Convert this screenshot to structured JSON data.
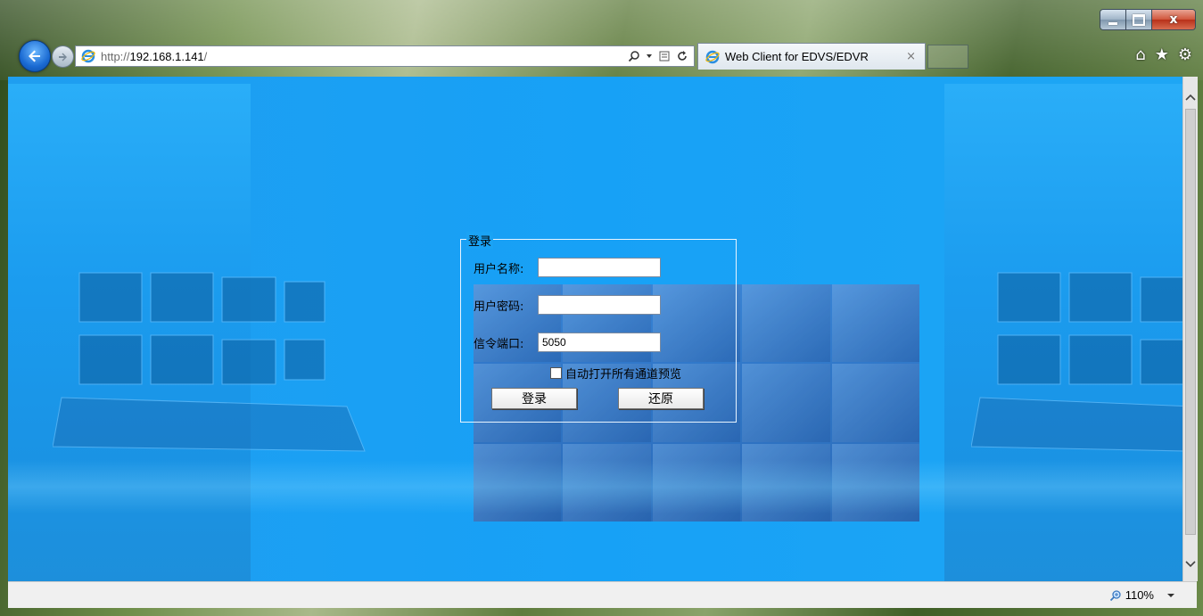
{
  "browser": {
    "url_prefix": "http://",
    "url_host": "192.168.1.141",
    "url_suffix": "/",
    "tab_title": "Web Client for EDVS/EDVR",
    "tab_close": "×",
    "zoom": "110%"
  },
  "login": {
    "legend": "登录",
    "username_label": "用户名称:",
    "username_value": "",
    "password_label": "用户密码:",
    "password_value": "",
    "port_label": "信令端口:",
    "port_value": "5050",
    "auto_open_label": "自动打开所有通道预览",
    "auto_open_checked": false,
    "login_button": "登录",
    "reset_button": "还原"
  },
  "colors": {
    "page_bg": "#1aa3f5",
    "accent": "#1a6ad2"
  },
  "icons": [
    "back-arrow-icon",
    "forward-arrow-icon",
    "ie-logo-icon",
    "search-icon",
    "compat-view-icon",
    "refresh-icon",
    "home-icon",
    "favorites-star-icon",
    "gear-icon",
    "zoom-icon"
  ]
}
